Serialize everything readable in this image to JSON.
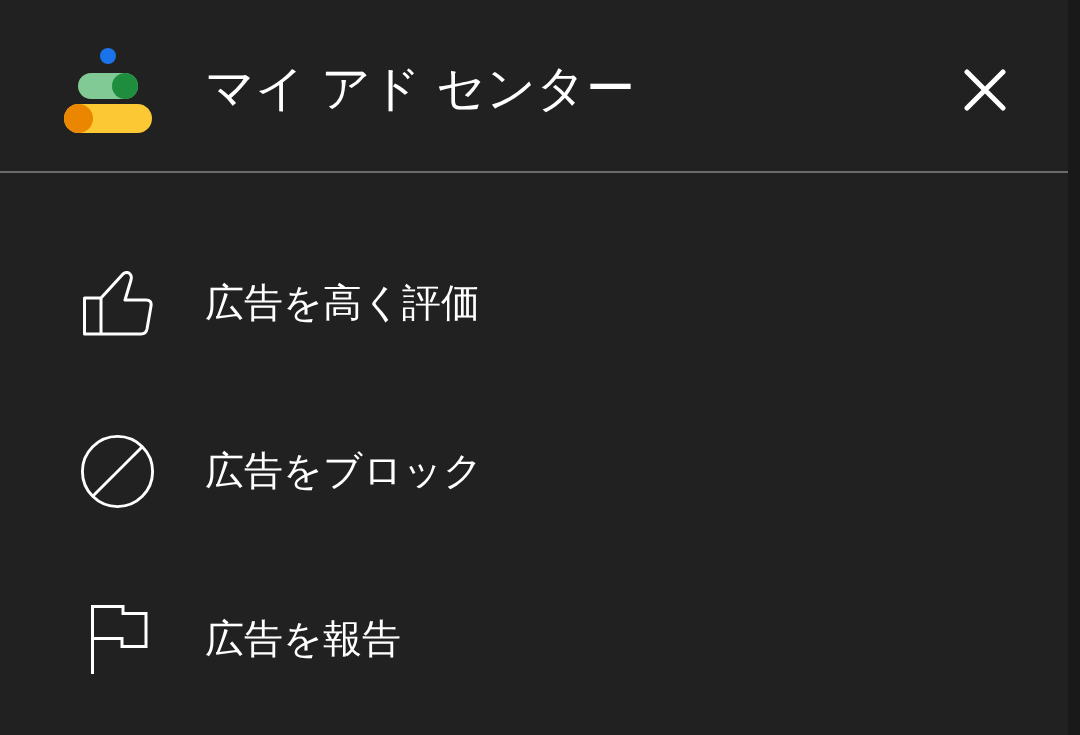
{
  "header": {
    "title": "マイ アド センター"
  },
  "menu": {
    "items": [
      {
        "kind": "like",
        "label": "広告を高く評価"
      },
      {
        "kind": "block",
        "label": "広告をブロック"
      },
      {
        "kind": "report",
        "label": "広告を報告"
      }
    ]
  }
}
